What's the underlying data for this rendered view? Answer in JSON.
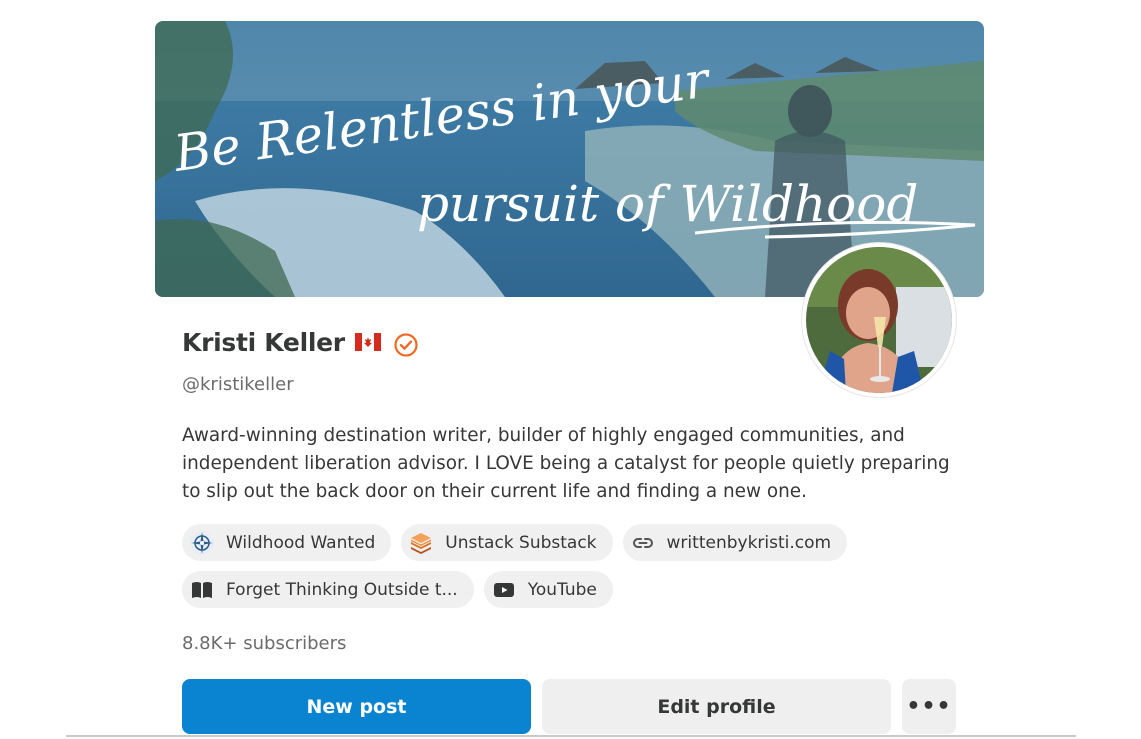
{
  "banner": {
    "line1": "Be Relentless in your",
    "line2": "pursuit of Wildhood"
  },
  "profile": {
    "name": "Kristi Keller",
    "flag_icon": "canada-flag-icon",
    "verified_icon": "verified-check-icon",
    "verified_color": "#f06a25",
    "handle": "@kristikeller",
    "bio": "Award-winning destination writer, builder of highly engaged communities, and independent liberation advisor. I LOVE being a catalyst for people quietly preparing to slip out the back door on their current life and finding a new one.",
    "subscribers": "8.8K+ subscribers"
  },
  "links": [
    {
      "label": "Wildhood Wanted",
      "icon": "compass-logo-icon"
    },
    {
      "label": "Unstack Substack",
      "icon": "substack-stack-icon"
    },
    {
      "label": "writtenbykristi.com",
      "icon": "link-icon"
    },
    {
      "label": "Forget Thinking Outside t...",
      "icon": "book-icon"
    },
    {
      "label": "YouTube",
      "icon": "youtube-icon"
    }
  ],
  "actions": {
    "new_post": "New post",
    "edit_profile": "Edit profile",
    "more": "•••"
  },
  "colors": {
    "primary_button": "#0a84d0",
    "chip_background": "#f0f0f0",
    "text": "#363737",
    "muted_text": "#6b6b6b"
  }
}
